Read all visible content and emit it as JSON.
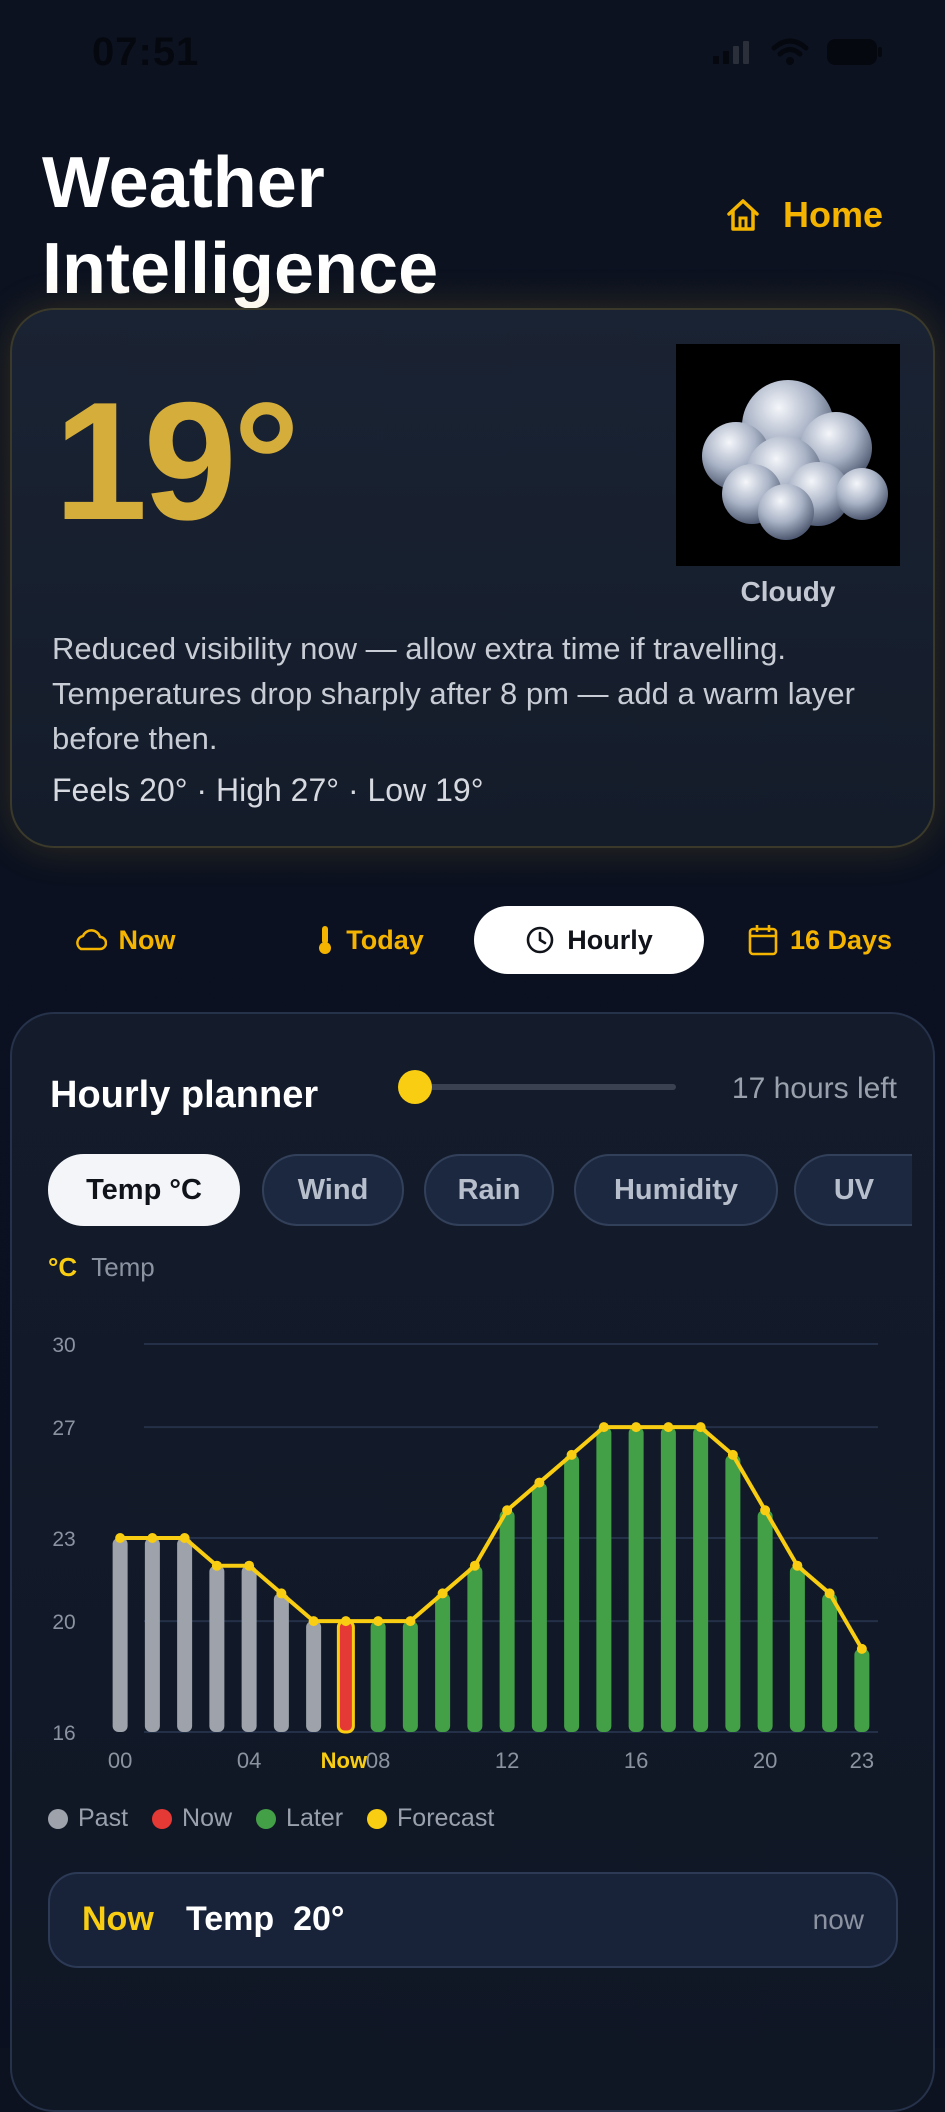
{
  "status": {
    "time": "07:51"
  },
  "header": {
    "title_line1": "Weather",
    "title_line2": "Intelligence",
    "home_label": "Home"
  },
  "current": {
    "temperature": "19°",
    "condition": "Cloudy",
    "advice_line1": "Reduced visibility now — allow extra time if travelling.",
    "advice_line2": "Temperatures drop sharply after 8 pm — add a warm layer before then.",
    "summary": "Feels 20° · High 27° · Low 19°"
  },
  "tabs": [
    {
      "label": "Now",
      "icon": "cloud-icon",
      "active": false
    },
    {
      "label": "Today",
      "icon": "thermometer-icon",
      "active": false
    },
    {
      "label": "Hourly",
      "icon": "clock-icon",
      "active": true
    },
    {
      "label": "16 Days",
      "icon": "calendar-icon",
      "active": false
    }
  ],
  "planner": {
    "title": "Hourly planner",
    "slider_value": 0,
    "hours_left": "17 hours left",
    "chips": [
      "Temp °C",
      "Wind",
      "Rain",
      "Humidity",
      "UV"
    ],
    "active_chip": "Temp °C",
    "unit": "°C",
    "metric_label": "Temp",
    "legend": [
      {
        "label": "Past",
        "color": "#9ea3ab"
      },
      {
        "label": "Now",
        "color": "#e53935"
      },
      {
        "label": "Later",
        "color": "#43a047"
      },
      {
        "label": "Forecast",
        "color": "#f8cd12"
      }
    ],
    "now_tag": "Now",
    "now_metric": "Temp",
    "now_value": "20°",
    "now_time": "now"
  },
  "chart_data": {
    "type": "bar",
    "x": [
      0,
      1,
      2,
      3,
      4,
      5,
      6,
      7,
      8,
      9,
      10,
      11,
      12,
      13,
      14,
      15,
      16,
      17,
      18,
      19,
      20,
      21,
      22,
      23
    ],
    "values": [
      23,
      23,
      23,
      22,
      22,
      21,
      20,
      20,
      20,
      20,
      21,
      22,
      24,
      25,
      26,
      27,
      27,
      27,
      27,
      26,
      24,
      22,
      21,
      19
    ],
    "bar_status": [
      "past",
      "past",
      "past",
      "past",
      "past",
      "past",
      "past",
      "now",
      "later",
      "later",
      "later",
      "later",
      "later",
      "later",
      "later",
      "later",
      "later",
      "later",
      "later",
      "later",
      "later",
      "later",
      "later",
      "later"
    ],
    "series": [
      {
        "name": "Forecast",
        "values": [
          23,
          23,
          23,
          22,
          22,
          21,
          20,
          20,
          20,
          20,
          21,
          22,
          24,
          25,
          26,
          27,
          27,
          27,
          27,
          26,
          24,
          22,
          21,
          19
        ]
      }
    ],
    "xtick_labels": [
      "00",
      "04",
      "Now",
      "08",
      "12",
      "16",
      "20",
      "23"
    ],
    "xtick_values": [
      0,
      4,
      7,
      8,
      12,
      16,
      20,
      23
    ],
    "yticks": [
      16,
      20,
      23,
      27,
      30
    ],
    "ylim": [
      16,
      30
    ],
    "xlabel": "",
    "ylabel": "Temp",
    "grid": true
  }
}
